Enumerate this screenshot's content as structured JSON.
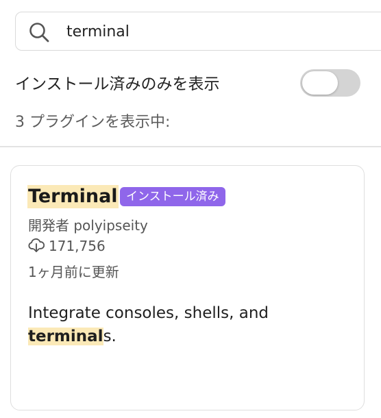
{
  "search": {
    "value": "terminal",
    "icon": "search-icon"
  },
  "filter": {
    "label": "インストール済みのみを表示",
    "enabled": false
  },
  "results": {
    "count_label": "3 プラグインを表示中:"
  },
  "plugin": {
    "name": "Terminal",
    "badge": "インストール済み",
    "author": "開発者 polyipseity",
    "downloads": "171,756",
    "download_icon": "download-cloud-icon",
    "updated": "1ヶ月前に更新",
    "description_prefix": "Integrate consoles, shells, and ",
    "description_highlight": "terminal",
    "description_suffix": "s."
  },
  "colors": {
    "highlight": "#fbe9b7",
    "badge": "#8f66ea",
    "toggle_off": "#d4d4d4"
  }
}
